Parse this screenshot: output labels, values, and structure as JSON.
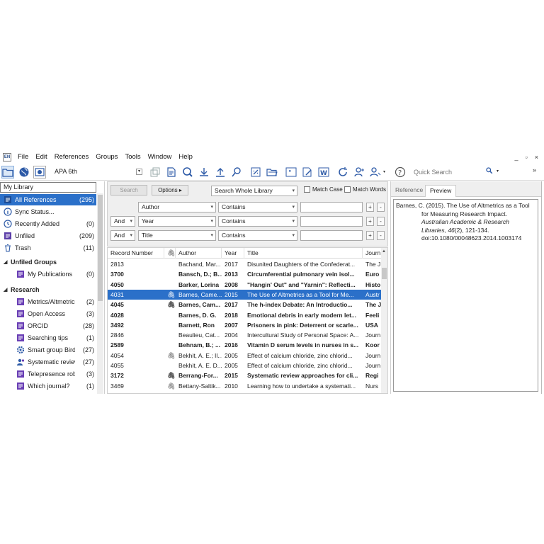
{
  "app_icon_text": "EN",
  "menu": [
    "File",
    "Edit",
    "References",
    "Groups",
    "Tools",
    "Window",
    "Help"
  ],
  "window_controls": {
    "minimize": "_",
    "restore": "▫",
    "close": "×"
  },
  "toolbar": {
    "output_style": "APA 6th",
    "quick_search_placeholder": "Quick Search",
    "more": "»"
  },
  "library": {
    "title": "My Library",
    "items": [
      {
        "label": "All References",
        "count": "(295)",
        "icon": "all-references-icon"
      },
      {
        "label": "Sync Status...",
        "count": "",
        "icon": "info-icon"
      },
      {
        "label": "Recently Added",
        "count": "(0)",
        "icon": "clock-icon"
      },
      {
        "label": "Unfiled",
        "count": "(209)",
        "icon": "unfiled-icon"
      },
      {
        "label": "Trash",
        "count": "(11)",
        "icon": "trash-icon"
      }
    ],
    "groups": [
      {
        "name": "Unfiled Groups",
        "items": [
          {
            "label": "My Publications",
            "count": "(0)"
          }
        ]
      },
      {
        "name": "Research",
        "items": [
          {
            "label": "Metrics/Altmetrics",
            "count": "(2)"
          },
          {
            "label": "Open Access",
            "count": "(3)"
          },
          {
            "label": "ORCID",
            "count": "(28)"
          },
          {
            "label": "Searching tips",
            "count": "(1)"
          },
          {
            "label": "Smart group Birds",
            "count": "(27)"
          },
          {
            "label": "Systematic reviews",
            "count": "(27)"
          },
          {
            "label": "Telepresence robots",
            "count": "(3)"
          },
          {
            "label": "Which journal?",
            "count": "(1)"
          }
        ]
      }
    ]
  },
  "search": {
    "search_button": "Search",
    "options_button": "Options",
    "options_arrow": "▸",
    "scope": "Search Whole Library",
    "match_case": "Match Case",
    "match_words": "Match Words",
    "rows": [
      {
        "bool": "",
        "field": "Author",
        "op": "Contains"
      },
      {
        "bool": "And",
        "field": "Year",
        "op": "Contains"
      },
      {
        "bool": "And",
        "field": "Title",
        "op": "Contains"
      }
    ],
    "plus": "+",
    "minus": "-"
  },
  "table": {
    "columns": [
      "Record Number",
      "",
      "Author",
      "Year",
      "Title",
      "Journ"
    ],
    "rows": [
      {
        "num": "2813",
        "clip": false,
        "author": "Bachand, Mar...",
        "year": "2017",
        "title": "Disunited Daughters of the Confederat...",
        "journal": "The J",
        "bold": false
      },
      {
        "num": "3700",
        "clip": false,
        "author": "Bansch, D.; B...",
        "year": "2013",
        "title": "Circumferential pulmonary vein isol...",
        "journal": "Euro",
        "bold": true
      },
      {
        "num": "4050",
        "clip": false,
        "author": "Barker, Lorina",
        "year": "2008",
        "title": "\"Hangin' Out\" and \"Yarnin\": Reflecti...",
        "journal": "Histo",
        "bold": true
      },
      {
        "num": "4031",
        "clip": true,
        "author": "Barnes, Came...",
        "year": "2015",
        "title": "The Use of Altmetrics as a Tool for Me...",
        "journal": "Austr",
        "bold": false
      },
      {
        "num": "4045",
        "clip": true,
        "author": "Barnes, Cam...",
        "year": "2017",
        "title": "The h-index Debate: An Introductio...",
        "journal": "The J",
        "bold": true
      },
      {
        "num": "4028",
        "clip": false,
        "author": "Barnes, D. G.",
        "year": "2018",
        "title": "Emotional debris in early modern let...",
        "journal": "Feeli",
        "bold": true
      },
      {
        "num": "3492",
        "clip": false,
        "author": "Barnett, Ron",
        "year": "2007",
        "title": "Prisoners in pink: Deterrent or scarle...",
        "journal": "USA",
        "bold": true
      },
      {
        "num": "2846",
        "clip": false,
        "author": "Beaulieu, Cat...",
        "year": "2004",
        "title": "Intercultural Study of Personal Space: A...",
        "journal": "Journ",
        "bold": false
      },
      {
        "num": "2589",
        "clip": false,
        "author": "Behnam, B.; ...",
        "year": "2016",
        "title": "Vitamin D serum levels in nurses in s...",
        "journal": "Koor",
        "bold": true
      },
      {
        "num": "4054",
        "clip": true,
        "author": "Bekhit, A. E.; Il...",
        "year": "2005",
        "title": "Effect of calcium chloride, zinc chlorid...",
        "journal": "Journ",
        "bold": false
      },
      {
        "num": "4055",
        "clip": false,
        "author": "Bekhit, A. E. D...",
        "year": "2005",
        "title": "Effect of calcium chloride, zinc chlorid...",
        "journal": "Journ",
        "bold": false
      },
      {
        "num": "3172",
        "clip": true,
        "author": "Berrang-For...",
        "year": "2015",
        "title": "Systematic review approaches for cli...",
        "journal": "Regi",
        "bold": true
      },
      {
        "num": "3469",
        "clip": true,
        "author": "Bettany-Saltik...",
        "year": "2010",
        "title": "Learning how to undertake a systemati...",
        "journal": "Nurs",
        "bold": false
      }
    ],
    "selected_index": 3
  },
  "right_panel": {
    "tabs": [
      "Reference",
      "Preview"
    ],
    "active_tab": "Preview",
    "preview": {
      "lead": "Barnes, C. (2015). The Use of Altmetrics as a Tool for Measuring Research Impact.",
      "journal": "Australian Academic & Research Libraries, 46",
      "rest": "(2), 121-134. doi:10.1080/00048623.2014.1003174"
    }
  },
  "colors": {
    "selection": "#2b70c9",
    "folder": "#2d5aa7",
    "group_purple": "#6a3fb5"
  }
}
